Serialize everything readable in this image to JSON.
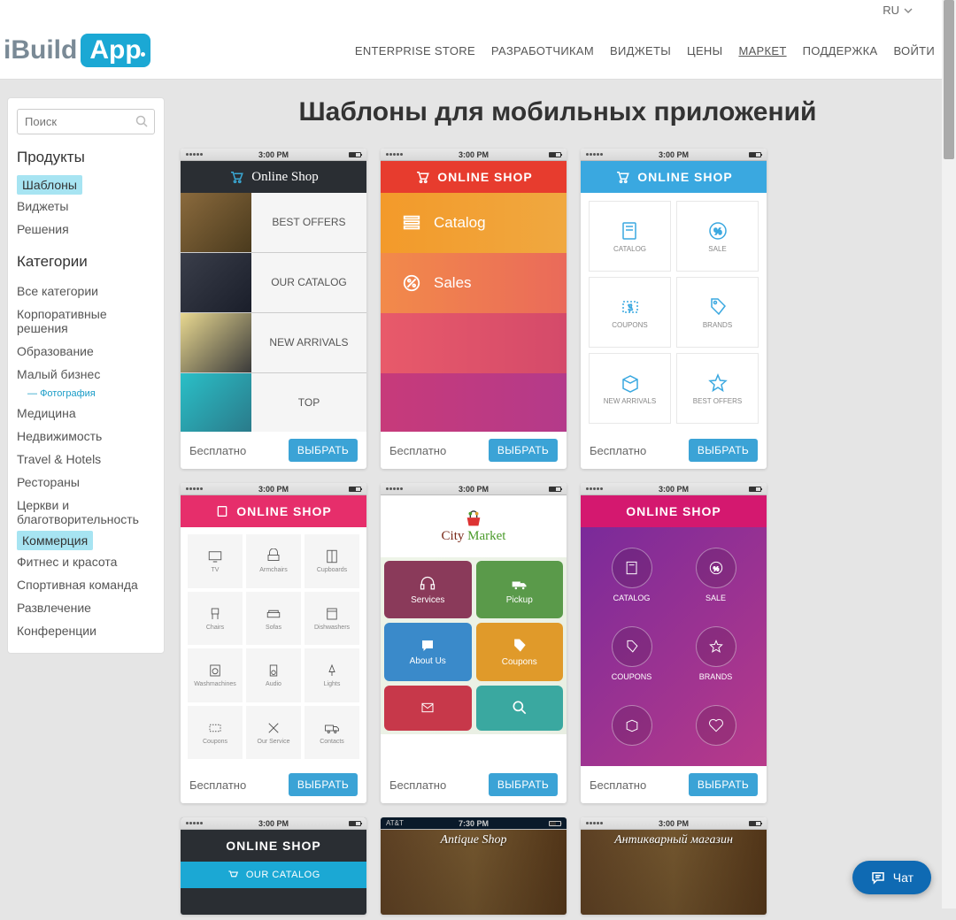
{
  "topbar": {
    "lang": "RU"
  },
  "nav": {
    "items": [
      "ENTERPRISE STORE",
      "РАЗРАБОТЧИКАМ",
      "ВИДЖЕТЫ",
      "ЦЕНЫ",
      "МАРКЕТ",
      "ПОДДЕРЖКА",
      "ВОЙТИ"
    ],
    "active_index": 4
  },
  "logo": {
    "part1": "iBuild",
    "part2": "App"
  },
  "search": {
    "placeholder": "Поиск"
  },
  "sidebar": {
    "products_heading": "Продукты",
    "products": [
      "Шаблоны",
      "Виджеты",
      "Решения"
    ],
    "products_selected_index": 0,
    "categories_heading": "Категории",
    "categories": [
      "Все категории",
      "Корпоративные решения",
      "Образование",
      "Малый бизнес",
      "Медицина",
      "Недвижимость",
      "Travel & Hotels",
      "Рестораны",
      "Церкви и благотворительность",
      "Коммерция",
      "Фитнес и красота",
      "Спортивная команда",
      "Развлечение",
      "Конференции"
    ],
    "sub_after_index": 3,
    "sub_label": "Фотография",
    "categories_selected_index": 9
  },
  "page": {
    "title": "Шаблоны для мобильных приложений"
  },
  "card_common": {
    "price": "Бесплатно",
    "button": "ВЫБРАТЬ",
    "status_time": "3:00 PM"
  },
  "cards": [
    {
      "header": "Online Shop",
      "rows": [
        "BEST OFFERS",
        "OUR CATALOG",
        "NEW ARRIVALS",
        "TOP"
      ]
    },
    {
      "header": "ONLINE SHOP",
      "rows": [
        "Catalog",
        "Sales"
      ]
    },
    {
      "header": "ONLINE SHOP",
      "cells": [
        "CATALOG",
        "SALE",
        "COUPONS",
        "BRANDS",
        "NEW ARRIVALS",
        "BEST OFFERS"
      ]
    },
    {
      "header": "ONLINE SHOP",
      "cells": [
        "TV",
        "Armchairs",
        "Cupboards",
        "Chairs",
        "Sofas",
        "Dishwashers",
        "Washmachines",
        "Audio",
        "Lights",
        "Coupons",
        "Our Service",
        "Contacts"
      ]
    },
    {
      "logo1": "City",
      "logo2": "Market",
      "cells": [
        "Services",
        "Pickup",
        "About Us",
        "Coupons"
      ]
    },
    {
      "header": "ONLINE SHOP",
      "cells": [
        "CATALOG",
        "SALE",
        "COUPONS",
        "BRANDS"
      ]
    },
    {
      "header": "ONLINE SHOP",
      "row": "OUR CATALOG"
    },
    {
      "header": "Antique Shop",
      "status_time": "7:30 PM",
      "carrier": "AT&T"
    },
    {
      "header": "Антикварный магазин"
    }
  ],
  "chat": {
    "label": "Чат"
  }
}
